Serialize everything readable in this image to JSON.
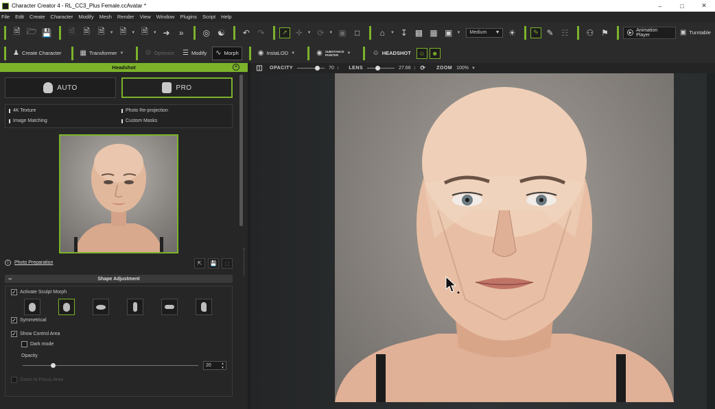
{
  "window": {
    "title": "Character Creator 4 - RL_CC3_Plus Female.ccAvatar *"
  },
  "menu": [
    "File",
    "Edit",
    "Create",
    "Character",
    "Modify",
    "Mesh",
    "Render",
    "View",
    "Window",
    "Plugins",
    "Script",
    "Help"
  ],
  "toolbar": {
    "quality_select": "Medium",
    "animation_player": "Animation Player",
    "turntable": "Turntable"
  },
  "toolbar2": {
    "create_character": "Create Character",
    "transformer": "Transformer",
    "optimize": "Optimize",
    "modify": "Modify",
    "morph": "Morph",
    "instalod": "InstaLOD",
    "substance_line1": "SUBSTANCE",
    "substance_line2": "PAINTER",
    "headshot": "HEADSHOT"
  },
  "panel": {
    "title": "Headshot",
    "mode_auto": "AUTO",
    "mode_pro": "PRO",
    "features": [
      "4K Texture",
      "Photo Re-projection",
      "Image Matching",
      "Custom Masks"
    ],
    "photo_preparation": "Photo Preparation",
    "shape_section": "Shape Adjustment",
    "activate_sculpt_morph": "Activate Sculpt Morph",
    "symmetrical": "Symmetrical",
    "show_control_area": "Show Control Area",
    "dark_mode": "Dark mode",
    "opacity_label": "Opacity",
    "opacity_value": "20",
    "opacity_fraction": 0.2,
    "zoom_to_focus": "Zoom to Focus Area"
  },
  "viewport": {
    "opacity_label": "OPACITY",
    "opacity_value": "70",
    "lens_label": "LENS",
    "lens_value": "27.66",
    "zoom_label": "ZOOM",
    "zoom_value": "100%"
  },
  "colors": {
    "accent": "#7cb32b",
    "panel_bg": "#262626",
    "viewport_bg": "#2b2e2f"
  }
}
